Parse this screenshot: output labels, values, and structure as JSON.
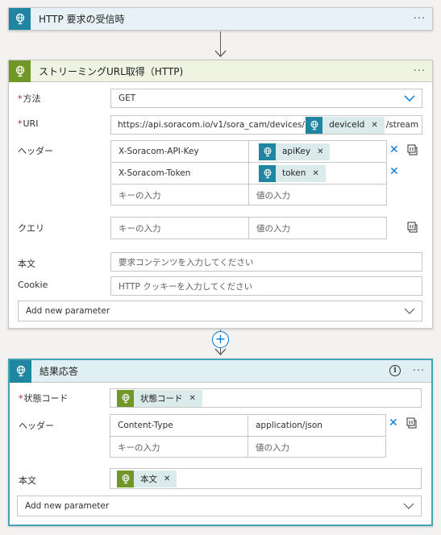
{
  "trigger": {
    "title": "HTTP 要求の受信時",
    "icon": "http-globe-icon",
    "color": "#1f85a0"
  },
  "stream_action": {
    "title": "ストリーミングURL取得（HTTP)",
    "icon": "http-globe-icon",
    "color": "#709727",
    "method": {
      "label": "方法",
      "value": "GET"
    },
    "uri": {
      "label": "URI",
      "prefix": "https://api.soracom.io/v1/sora_cam/devices/",
      "token": "deviceId",
      "suffix": "/stream"
    },
    "headers": {
      "label": "ヘッダー",
      "rows": [
        {
          "key": "X-Soracom-API-Key",
          "value_token": "apiKey"
        },
        {
          "key": "X-Soracom-Token",
          "value_token": "token"
        }
      ],
      "key_placeholder": "キーの入力",
      "value_placeholder": "値の入力"
    },
    "query": {
      "label": "クエリ",
      "key_placeholder": "キーの入力",
      "value_placeholder": "値の入力"
    },
    "body": {
      "label": "本文",
      "placeholder": "要求コンテンツを入力してください"
    },
    "cookie": {
      "label": "Cookie",
      "placeholder": "HTTP クッキーを入力してください"
    },
    "add_param": "Add new parameter"
  },
  "response_action": {
    "title": "結果応答",
    "icon": "http-globe-icon",
    "color": "#1f85a0",
    "status": {
      "label": "状態コード",
      "token": "状態コード"
    },
    "headers": {
      "label": "ヘッダー",
      "rows": [
        {
          "key": "Content-Type",
          "value": "application/json"
        }
      ],
      "key_placeholder": "キーの入力",
      "value_placeholder": "値の入力"
    },
    "body": {
      "label": "本文",
      "token": "本文"
    },
    "add_param": "Add new parameter"
  },
  "colors": {
    "accent": "#0078d4",
    "required": "#a4262c",
    "token_bg": "#dbeaeb",
    "token_icon": "#1f85a0"
  }
}
